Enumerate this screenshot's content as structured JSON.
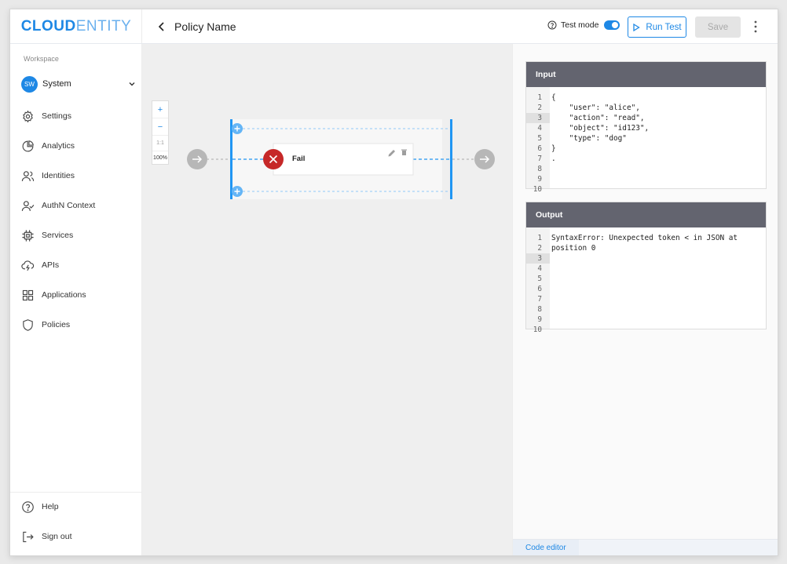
{
  "app": {
    "logo_bold": "CLOUD",
    "logo_light": "ENTITY"
  },
  "sidebar": {
    "workspace_label": "Workspace",
    "workspace_badge": "SW",
    "workspace_name": "System",
    "items": [
      {
        "label": "Settings",
        "icon": "gear-icon"
      },
      {
        "label": "Analytics",
        "icon": "pie-chart-icon"
      },
      {
        "label": "Identities",
        "icon": "users-icon"
      },
      {
        "label": "AuthN Context",
        "icon": "user-check-icon"
      },
      {
        "label": "Services",
        "icon": "chip-icon"
      },
      {
        "label": "APIs",
        "icon": "cloud-lightning-icon"
      },
      {
        "label": "Applications",
        "icon": "grid-icon"
      },
      {
        "label": "Policies",
        "icon": "shield-icon"
      }
    ],
    "bottom": [
      {
        "label": "Help",
        "icon": "help-circle-icon"
      },
      {
        "label": "Sign out",
        "icon": "sign-out-icon"
      }
    ]
  },
  "header": {
    "title": "Policy Name",
    "test_mode_label": "Test mode",
    "test_mode_on": true,
    "run_test_label": "Run Test",
    "save_label": "Save"
  },
  "canvas": {
    "zoom_in": "+",
    "zoom_out": "−",
    "zoom_reset": "1:1",
    "zoom_level": "100%",
    "node_label": "Fail"
  },
  "input_panel": {
    "title": "Input",
    "line_numbers": [
      "1",
      "2",
      "3",
      "4",
      "5",
      "6",
      "7",
      "8",
      "9",
      "10"
    ],
    "active_line": 3,
    "lines": [
      "{",
      "    \"user\": \"alice\",",
      "    \"action\": \"read\",",
      "    \"object\": \"id123\",",
      "    \"type\": \"dog\"",
      "}",
      ".",
      "",
      "",
      ""
    ]
  },
  "output_panel": {
    "title": "Output",
    "line_numbers": [
      "1",
      "2",
      "3",
      "4",
      "5",
      "6",
      "7",
      "8",
      "9",
      "10"
    ],
    "active_line": 3,
    "lines": [
      "SyntaxError: Unexpected token < in JSON at",
      "position 0",
      "",
      "",
      "",
      "",
      "",
      "",
      "",
      ""
    ]
  },
  "footer": {
    "tab_label": "Code editor"
  },
  "colors": {
    "accent": "#1e88e5",
    "fail": "#c62828",
    "panel_header": "#63646f"
  }
}
